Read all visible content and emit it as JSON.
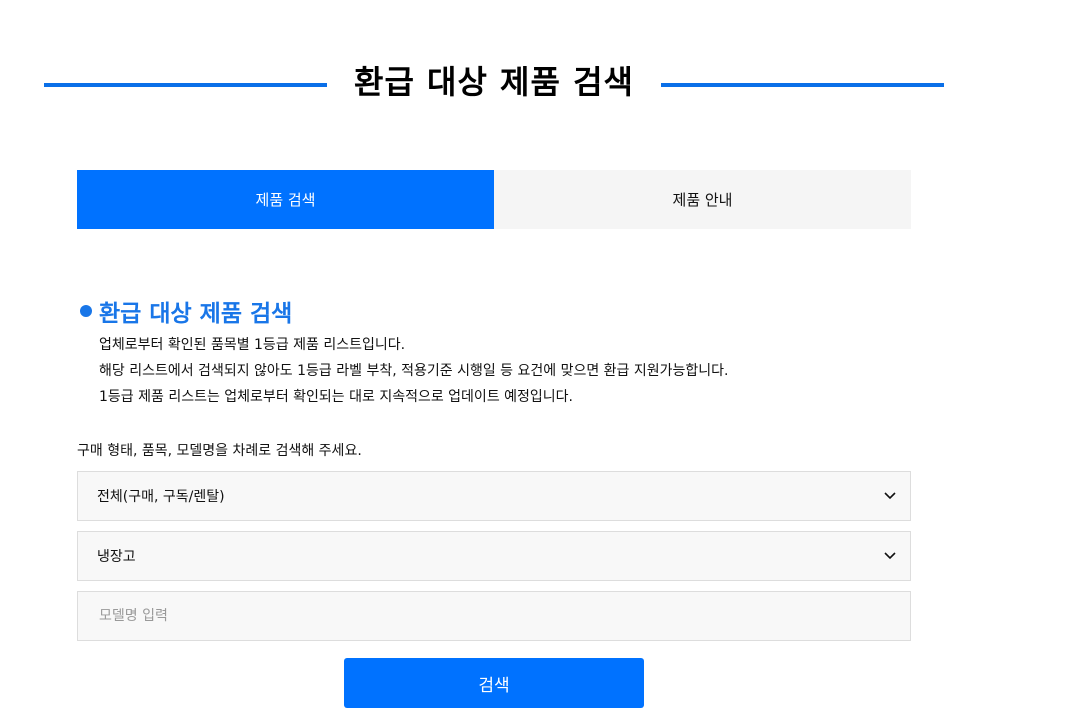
{
  "header": {
    "title": "환급 대상 제품 검색"
  },
  "tabs": [
    {
      "label": "제품 검색",
      "active": true
    },
    {
      "label": "제품 안내",
      "active": false
    }
  ],
  "section": {
    "heading": "환급 대상 제품 검색",
    "description": [
      "업체로부터 확인된 품목별 1등급 제품 리스트입니다.",
      "해당 리스트에서 검색되지 않아도 1등급 라벨 부착, 적용기준 시행일 등 요건에 맞으면 환급 지원가능합니다.",
      "1등급 제품 리스트는 업체로부터 확인되는 대로 지속적으로 업데이트 예정입니다."
    ]
  },
  "form": {
    "instruction": "구매 형태, 품목, 모델명을 차례로 검색해 주세요.",
    "purchase_type": {
      "value": "전체(구매, 구독/렌탈)",
      "icon": "chevron-down-icon"
    },
    "category": {
      "value": "냉장고",
      "icon": "chevron-down-icon"
    },
    "model_input": {
      "value": "",
      "placeholder": "모델명 입력"
    },
    "search_label": "검색"
  },
  "colors": {
    "accent": "#0072FF",
    "heading_blue": "#1976E8",
    "tab_inactive_bg": "#F5F5F5",
    "field_bg": "#F8F8F8",
    "field_border": "#DDDDDD"
  }
}
